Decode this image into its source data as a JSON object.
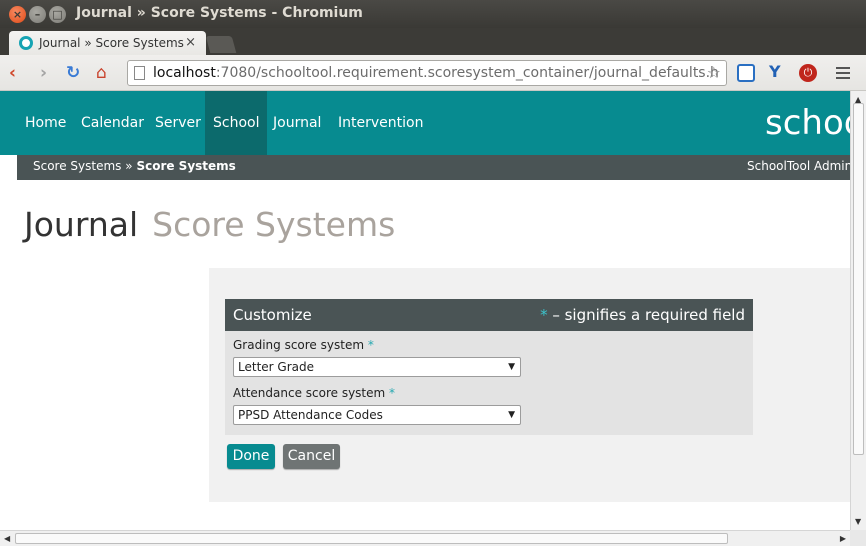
{
  "window": {
    "title": "Journal » Score Systems - Chromium"
  },
  "tab": {
    "title": "Journal » Score Systems",
    "close_glyph": "×"
  },
  "toolbar": {
    "url_host": "localhost",
    "url_rest": ":7080/schooltool.requirement.scoresystem_container/journal_defaults.h",
    "back_glyph": "‹",
    "forward_glyph": "›",
    "reload_glyph": "↻",
    "home_glyph": "⌂",
    "star_glyph": "☆",
    "ext_y_glyph": "Y",
    "ext_stop_glyph": "⏻"
  },
  "nav": {
    "items": [
      {
        "label": "Home",
        "active": false
      },
      {
        "label": "Calendar",
        "active": false
      },
      {
        "label": "Server",
        "active": false
      },
      {
        "label": "School",
        "active": true
      },
      {
        "label": "Journal",
        "active": false
      },
      {
        "label": "Intervention",
        "active": false
      }
    ],
    "brand": "schooltool"
  },
  "breadcrumb": {
    "parent": "Score Systems",
    "separator": "»",
    "current": "Score Systems"
  },
  "user": {
    "label": "SchoolTool Administrator"
  },
  "page": {
    "title": "Journal",
    "subtitle": "Score Systems"
  },
  "form": {
    "heading": "Customize",
    "required_star": "*",
    "required_note": "– signifies a required field",
    "grading_label": "Grading score system",
    "grading_value": "Letter Grade",
    "attendance_label": "Attendance score system",
    "attendance_value": "PPSD Attendance Codes",
    "select_arrow": "▼",
    "done_label": "Done",
    "cancel_label": "Cancel"
  },
  "colors": {
    "accent": "#078b90",
    "accent_active": "#0c6a6c",
    "dark_bar": "#4a5455"
  }
}
